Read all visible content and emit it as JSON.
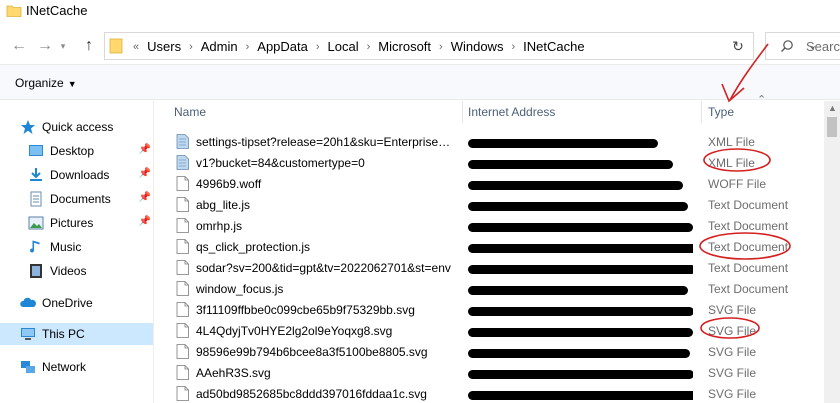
{
  "window": {
    "title": "INetCache"
  },
  "address_bar": {
    "overflow": "«",
    "crumbs": [
      "Users",
      "Admin",
      "AppData",
      "Local",
      "Microsoft",
      "Windows",
      "INetCache"
    ]
  },
  "search": {
    "placeholder": "Searc"
  },
  "command_bar": {
    "organize_label": "Organize"
  },
  "nav_pane": {
    "items": [
      {
        "label": "Quick access",
        "icon": "star-icon",
        "pinned": false
      },
      {
        "label": "Desktop",
        "icon": "desktop-icon",
        "pinned": true
      },
      {
        "label": "Downloads",
        "icon": "downloads-icon",
        "pinned": true
      },
      {
        "label": "Documents",
        "icon": "documents-icon",
        "pinned": true
      },
      {
        "label": "Pictures",
        "icon": "pictures-icon",
        "pinned": true
      },
      {
        "label": "Music",
        "icon": "music-icon",
        "pinned": false
      },
      {
        "label": "Videos",
        "icon": "videos-icon",
        "pinned": false
      },
      {
        "label": "OneDrive",
        "icon": "onedrive-icon",
        "pinned": false
      },
      {
        "label": "This PC",
        "icon": "this-pc-icon",
        "pinned": false,
        "selected": true
      },
      {
        "label": "Network",
        "icon": "network-icon",
        "pinned": false
      }
    ]
  },
  "file_list": {
    "columns": {
      "name": "Name",
      "internet_address": "Internet Address",
      "type": "Type"
    },
    "rows": [
      {
        "name": "settings-tipset?release=20h1&sku=Enterprise&...",
        "type": "XML File",
        "icon": "xml-file-icon"
      },
      {
        "name": "v1?bucket=84&customertype=0",
        "type": "XML File",
        "icon": "xml-file-icon"
      },
      {
        "name": "4996b9.woff",
        "type": "WOFF File",
        "icon": "generic-file-icon"
      },
      {
        "name": "abg_lite.js",
        "type": "Text Document",
        "icon": "generic-file-icon"
      },
      {
        "name": "omrhp.js",
        "type": "Text Document",
        "icon": "generic-file-icon"
      },
      {
        "name": "qs_click_protection.js",
        "type": "Text Document",
        "icon": "generic-file-icon"
      },
      {
        "name": "sodar?sv=200&tid=gpt&tv=2022062701&st=env",
        "type": "Text Document",
        "icon": "generic-file-icon"
      },
      {
        "name": "window_focus.js",
        "type": "Text Document",
        "icon": "generic-file-icon"
      },
      {
        "name": "3f11109ffbbe0c099cbe65b9f75329bb.svg",
        "type": "SVG File",
        "icon": "generic-file-icon"
      },
      {
        "name": "4L4QdyjTv0HYE2lg2ol9eYoqxg8.svg",
        "type": "SVG File",
        "icon": "generic-file-icon"
      },
      {
        "name": "98596e99b794b6bcee8a3f5100be8805.svg",
        "type": "SVG File",
        "icon": "generic-file-icon"
      },
      {
        "name": "AAehR3S.svg",
        "type": "SVG File",
        "icon": "generic-file-icon"
      },
      {
        "name": "ad50bd9852685bc8ddd397016fddaa1c.svg",
        "type": "SVG File",
        "icon": "generic-file-icon"
      }
    ]
  },
  "colors": {
    "selection": "#cce8ff",
    "header_text": "#4c607a",
    "annotation": "#d42020",
    "accent": "#0063b1"
  }
}
